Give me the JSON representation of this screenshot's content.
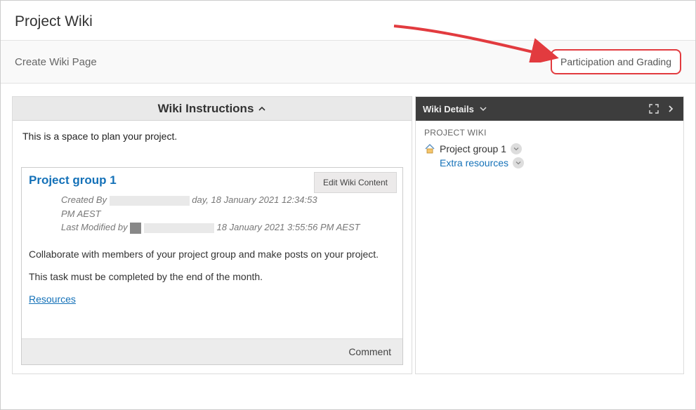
{
  "title": "Project Wiki",
  "actionbar": {
    "create_label": "Create Wiki Page",
    "grading_label": "Participation and Grading"
  },
  "instructions_panel": {
    "heading": "Wiki Instructions",
    "intro": "This is a space to plan your project."
  },
  "wiki_page": {
    "title": "Project group 1",
    "edit_label": "Edit Wiki Content",
    "created_by_prefix": "Created By",
    "created_by_suffix": "day, 18 January 2021 12:34:53",
    "created_by_line2": "PM AEST",
    "modified_prefix": "Last Modified by",
    "modified_suffix": "18 January 2021 3:55:56 PM AEST",
    "body_p1": "Collaborate with members of your project group and make posts on your project.",
    "body_p2": "This task must be completed by the end of the month.",
    "resources_link": "Resources",
    "comment_label": "Comment"
  },
  "details_panel": {
    "heading": "Wiki Details",
    "section_label": "PROJECT WIKI",
    "tree": {
      "root": "Project group 1",
      "child": "Extra resources"
    }
  }
}
